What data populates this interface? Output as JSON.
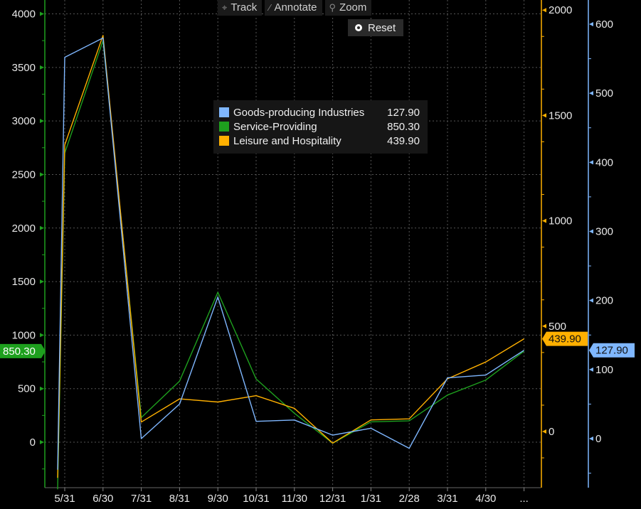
{
  "toolbar": {
    "track_label": "Track",
    "annotate_label": "Annotate",
    "zoom_label": "Zoom",
    "reset_label": "Reset",
    "track_icon": "crosshair-icon",
    "annotate_icon": "pencil-icon",
    "zoom_icon": "magnifier-icon",
    "reset_icon": "radio-dot-icon"
  },
  "legend": {
    "items": [
      {
        "name": "Goods-producing Industries",
        "value": "127.90",
        "color": "#7fb7ff"
      },
      {
        "name": "Service-Providing",
        "value": "850.30",
        "color": "#1ea01e"
      },
      {
        "name": "Leisure and Hospitality",
        "value": "439.90",
        "color": "#ffb000"
      }
    ]
  },
  "chart_data": {
    "type": "line",
    "title": "",
    "x": [
      "5/31",
      "6/30",
      "7/31",
      "8/31",
      "9/30",
      "10/31",
      "11/30",
      "12/31",
      "1/31",
      "2/28",
      "3/31",
      "4/30",
      "..."
    ],
    "grid": true,
    "axes": {
      "left": {
        "ticks": [
          0,
          500,
          1000,
          1500,
          2000,
          2500,
          3000,
          3500,
          4000
        ],
        "range": [
          -440,
          4050
        ],
        "color": "#1ea01e"
      },
      "right_inner": {
        "ticks": [
          0,
          500,
          1000,
          1500,
          2000
        ],
        "range": [
          -220,
          2030
        ],
        "color": "#ffb000"
      },
      "right_outer": {
        "ticks": [
          0,
          100,
          200,
          300,
          400,
          500,
          600
        ],
        "range": [
          -45,
          620
        ],
        "color": "#7fb7ff"
      }
    },
    "series": [
      {
        "name": "Service-Providing",
        "axis": "left",
        "color": "#1ea01e",
        "values": [
          -440,
          2700,
          3750,
          230,
          570,
          1400,
          590,
          270,
          -10,
          190,
          200,
          440,
          580,
          850.3
        ]
      },
      {
        "name": "Leisure and Hospitality",
        "axis": "right_inner",
        "color": "#ffb000",
        "values": [
          -220,
          1360,
          1880,
          45,
          155,
          140,
          170,
          110,
          -55,
          55,
          60,
          250,
          330,
          439.9
        ]
      },
      {
        "name": "Goods-producing Industries",
        "axis": "right_outer",
        "color": "#7fb7ff",
        "values": [
          -45,
          552,
          580,
          0,
          50,
          205,
          25,
          27,
          5,
          15,
          -14,
          88,
          92,
          127.9
        ]
      }
    ],
    "last_value_tags": [
      {
        "series": "Service-Providing",
        "label": "850.30",
        "axis": "left"
      },
      {
        "series": "Leisure and Hospitality",
        "label": "439.90",
        "axis": "right_inner"
      },
      {
        "series": "Goods-producing Industries",
        "label": "127.90",
        "axis": "right_outer"
      }
    ]
  }
}
